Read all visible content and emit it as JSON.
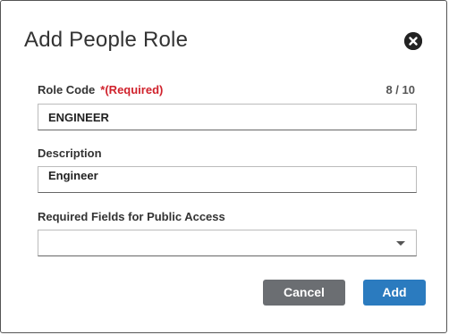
{
  "dialog": {
    "title": "Add People Role"
  },
  "role_code": {
    "label": "Role Code",
    "required_text": "*(Required)",
    "counter": "8 / 10",
    "value": "ENGINEER"
  },
  "description": {
    "label": "Description",
    "value": "Engineer"
  },
  "public_access": {
    "label": "Required Fields for Public Access",
    "value": ""
  },
  "buttons": {
    "cancel": "Cancel",
    "add": "Add"
  },
  "colors": {
    "required": "#d0222c",
    "cancel_bg": "#6b6e72",
    "add_bg": "#2b7bbf"
  },
  "icons": {
    "close": "close-circle-icon",
    "dropdown": "chevron-down-icon"
  }
}
